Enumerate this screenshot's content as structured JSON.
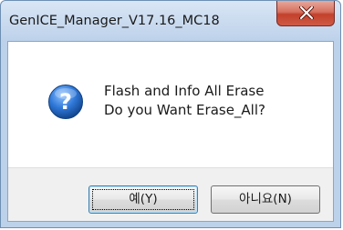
{
  "window": {
    "title": "GenICE_Manager_V17.16_MC18"
  },
  "icons": {
    "dialog_icon": "question-icon",
    "close_icon": "close-icon"
  },
  "message": {
    "line1": "Flash and Info All Erase",
    "line2": "Do you Want Erase_All?"
  },
  "buttons": {
    "yes_label": "예(Y)",
    "no_label": "아니요(N)"
  },
  "colors": {
    "close_button": "#c7432f",
    "default_button_border": "#3c7fb1",
    "question_icon": "#1f5fbf"
  }
}
